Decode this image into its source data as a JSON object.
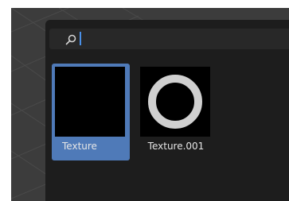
{
  "search": {
    "icon": "search-icon",
    "value": "",
    "placeholder": ""
  },
  "textures": [
    {
      "label": "Texture",
      "selected": true,
      "preview": "solid-black"
    },
    {
      "label": "Texture.001",
      "selected": false,
      "preview": "gray-ring"
    }
  ],
  "colors": {
    "selection": "#4f7ab8",
    "caret": "#4a90e8",
    "ring": "#d0d0d0"
  }
}
